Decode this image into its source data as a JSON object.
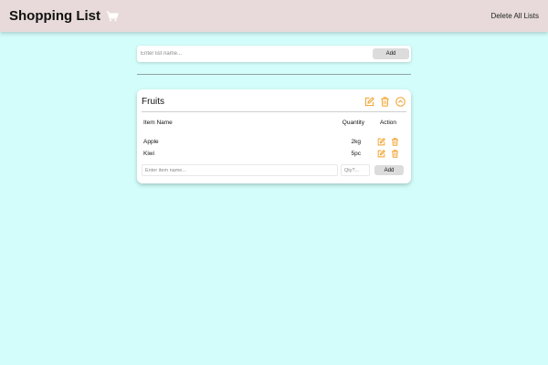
{
  "header": {
    "title": "Shopping List",
    "cart_icon": "cart-icon",
    "delete_all_label": "Delete All Lists",
    "background": "#e8dada"
  },
  "new_list": {
    "placeholder": "Enter list name...",
    "add_label": "Add"
  },
  "lists": [
    {
      "title": "Fruits",
      "icons": [
        "edit-icon",
        "trash-icon",
        "collapse-chevron-up-icon"
      ],
      "columns": {
        "name": "Item Name",
        "quantity": "Quantity",
        "action": "Action"
      },
      "items": [
        {
          "name": "Apple",
          "quantity": "2kg"
        },
        {
          "name": "Kiwi",
          "quantity": "5pc"
        }
      ],
      "add_item": {
        "name_placeholder": "Enter item name...",
        "qty_placeholder": "Qty?...",
        "add_label": "Add"
      }
    }
  ],
  "colors": {
    "page_background": "#d3fdfa",
    "accent_orange": "#f0a028",
    "card_background": "#ffffff"
  }
}
